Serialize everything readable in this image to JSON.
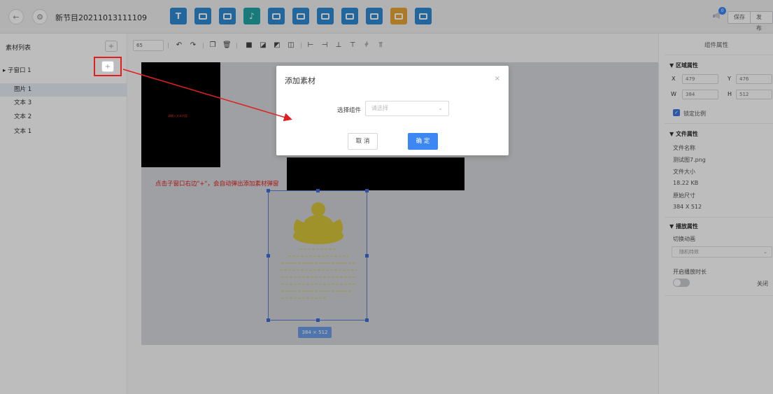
{
  "topbar": {
    "title": "新节目20211013111109",
    "back_icon": "←",
    "settings_icon": "⚙",
    "save_label": "保存",
    "publish_label": "发布",
    "badge": "0",
    "tools": [
      {
        "name": "text-tool-icon",
        "color": "#2d8bd4",
        "glyph": "T"
      },
      {
        "name": "video-tool-icon",
        "color": "#2d8bd4",
        "glyph": ""
      },
      {
        "name": "image-tool-icon",
        "color": "#2d8bd4",
        "glyph": ""
      },
      {
        "name": "audio-tool-icon",
        "color": "#21a5a5",
        "glyph": "♪"
      },
      {
        "name": "folder-tool-icon",
        "color": "#2d8bd4",
        "glyph": ""
      },
      {
        "name": "weather-tool-icon",
        "color": "#2d8bd4",
        "glyph": ""
      },
      {
        "name": "document-tool-icon",
        "color": "#2d8bd4",
        "glyph": ""
      },
      {
        "name": "webpage-tool-icon",
        "color": "#2d8bd4",
        "glyph": ""
      },
      {
        "name": "clock-tool-icon",
        "color": "#2d8bd4",
        "glyph": ""
      },
      {
        "name": "marquee-tool-icon",
        "color": "#e9a632",
        "glyph": ""
      },
      {
        "name": "window-tool-icon",
        "color": "#2d8bd4",
        "glyph": ""
      }
    ]
  },
  "left": {
    "title": "素材列表",
    "group": "子窗口 1",
    "items": [
      "图片 1",
      "文本 3",
      "文本 2",
      "文本 1"
    ]
  },
  "toolbar": {
    "zoom": "65",
    "tools": [
      "undo",
      "redo",
      "copy",
      "delete",
      "bring-front",
      "send-back",
      "bring-forward",
      "send-backward",
      "align-left",
      "align-right",
      "align-bottom",
      "align-top",
      "align-h-center",
      "align-v-center"
    ]
  },
  "canvas": {
    "tiny_text": "请输入文本内容",
    "hint": "点击子窗口右边\"+\"，会自动弹出添加素材弹窗",
    "size_tag": "384 × 512"
  },
  "right": {
    "title": "组件属性",
    "region_section": "▼ 区域属性",
    "x_label": "X",
    "x_value": "479",
    "y_label": "Y",
    "y_value": "476",
    "w_label": "W",
    "w_value": "384",
    "h_label": "H",
    "h_value": "512",
    "lock_ratio": "锁定比例",
    "file_section": "▼ 文件属性",
    "file_name_label": "文件名称",
    "file_name": "测试图7.png",
    "file_size_label": "文件大小",
    "file_size": "18.22 KB",
    "orig_size_label": "原始尺寸",
    "orig_size": "384 X 512",
    "play_section": "▼ 播放属性",
    "transition_label": "切换动画",
    "transition_value": "随机特效",
    "duration_label": "开启播放时长",
    "duration_state": "关闭"
  },
  "dialog": {
    "title": "添加素材",
    "close": "×",
    "select_label": "选择组件",
    "select_placeholder": "请选择",
    "cancel_label": "取 消",
    "ok_label": "确 定"
  },
  "colors": {
    "accent": "#3d87f5",
    "annotation": "#e02020"
  }
}
